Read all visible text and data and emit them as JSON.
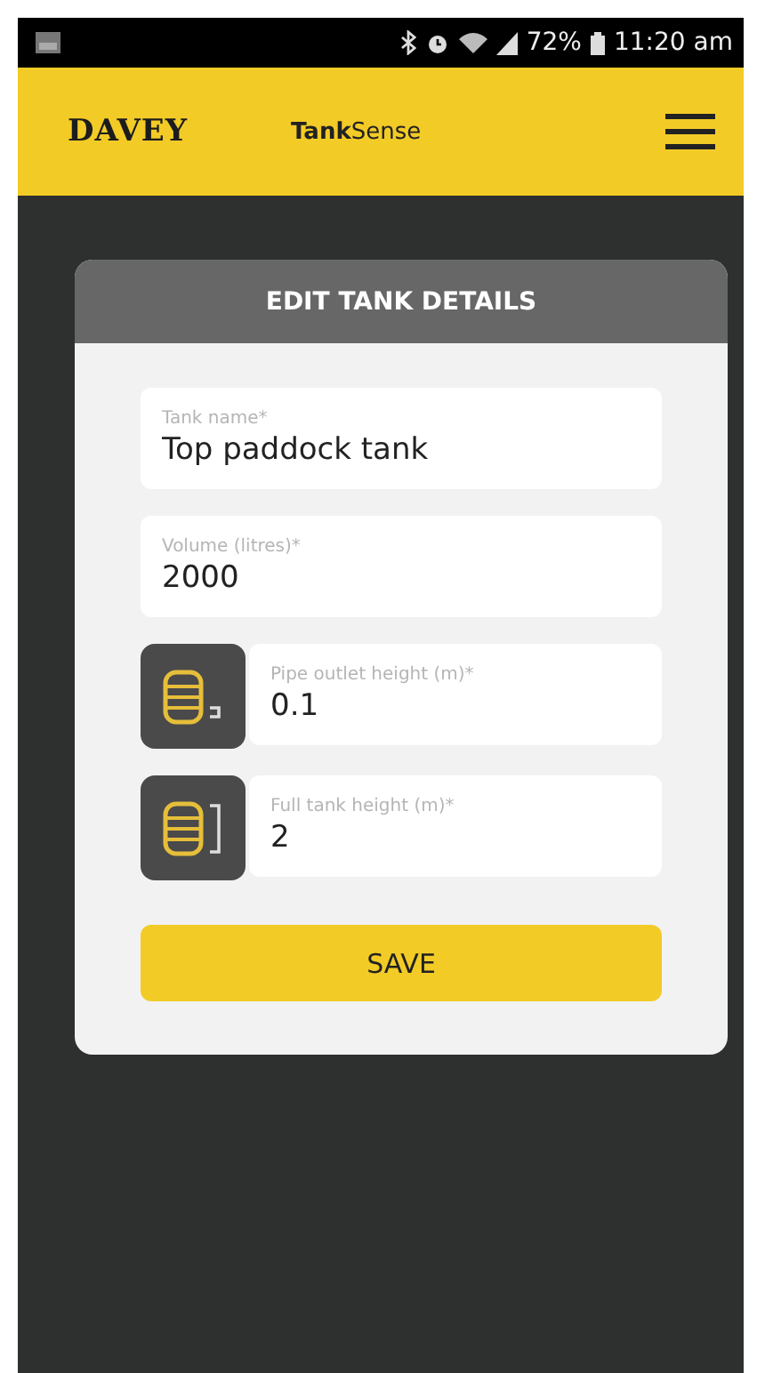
{
  "status_bar": {
    "battery": "72%",
    "time": "11:20 am"
  },
  "header": {
    "brand": "DAVEY",
    "app_name": "**Tank**Sense"
  },
  "card": {
    "title": "EDIT TANK DETAILS",
    "fields": [
      {
        "kind": "plain",
        "label": "Tank name*",
        "value": "Top paddock tank"
      },
      {
        "kind": "plain",
        "label": "Volume (litres)*",
        "value": "2000"
      },
      {
        "kind": "outlet",
        "label": "Pipe outlet height (m)*",
        "value": "0.1"
      },
      {
        "kind": "full",
        "label": "Full tank height (m)*",
        "value": "2"
      }
    ],
    "button": "SAVE"
  }
}
